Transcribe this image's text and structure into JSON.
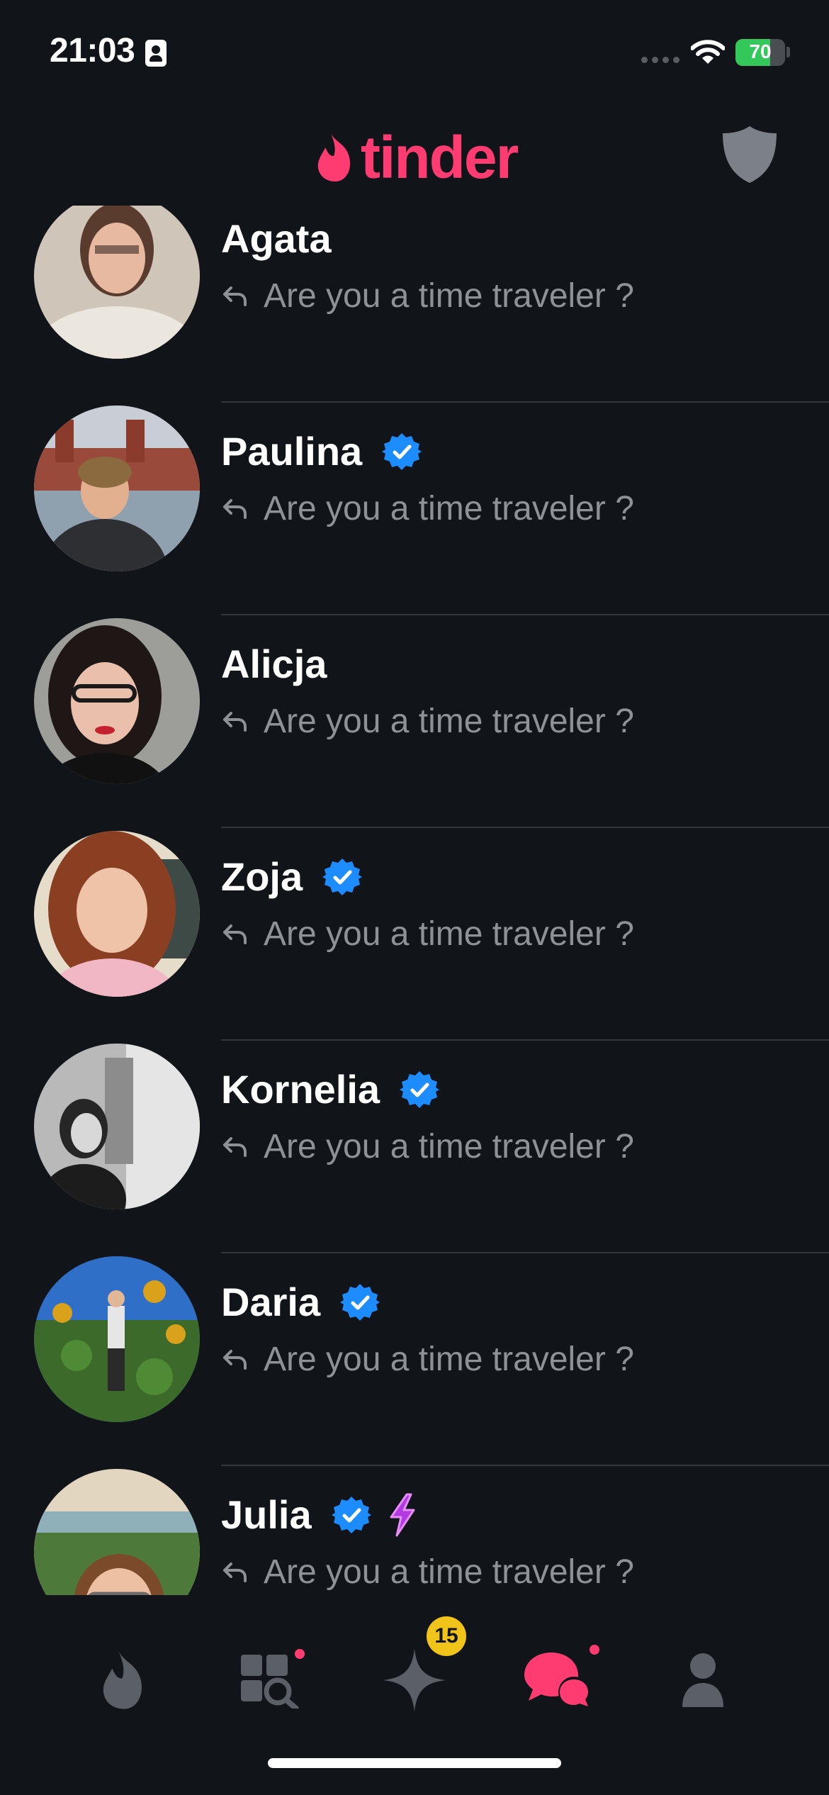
{
  "status_bar": {
    "time": "21:03",
    "battery": "70",
    "battery_level": 0.7
  },
  "header": {
    "logo_text": "tinder"
  },
  "messages": [
    {
      "name": "Agata",
      "preview": "Are you a time traveler ?",
      "verified": false,
      "boost": false
    },
    {
      "name": "Paulina",
      "preview": "Are you a time traveler ?",
      "verified": true,
      "boost": false
    },
    {
      "name": "Alicja",
      "preview": "Are you a time traveler ?",
      "verified": false,
      "boost": false
    },
    {
      "name": "Zoja",
      "preview": "Are you a time traveler ?",
      "verified": true,
      "boost": false
    },
    {
      "name": "Kornelia",
      "preview": "Are you a time traveler ?",
      "verified": true,
      "boost": false
    },
    {
      "name": "Daria",
      "preview": "Are you a time traveler ?",
      "verified": true,
      "boost": false
    },
    {
      "name": "Julia",
      "preview": "Are you a time traveler ?",
      "verified": true,
      "boost": true
    }
  ],
  "tab_bar": {
    "tabs": [
      {
        "name": "home",
        "icon": "flame-icon",
        "active": false
      },
      {
        "name": "explore",
        "icon": "explore-icon",
        "active": false,
        "dot": true
      },
      {
        "name": "likes",
        "icon": "sparkle-icon",
        "active": false,
        "badge": "15"
      },
      {
        "name": "chat",
        "icon": "chat-icon",
        "active": true,
        "dot": true
      },
      {
        "name": "profile",
        "icon": "profile-icon",
        "active": false
      }
    ]
  },
  "colors": {
    "brand": "#fe3c72",
    "verified": "#1d8cff",
    "background": "#111418",
    "boost": "#b23be0",
    "badge": "#f0c419"
  }
}
